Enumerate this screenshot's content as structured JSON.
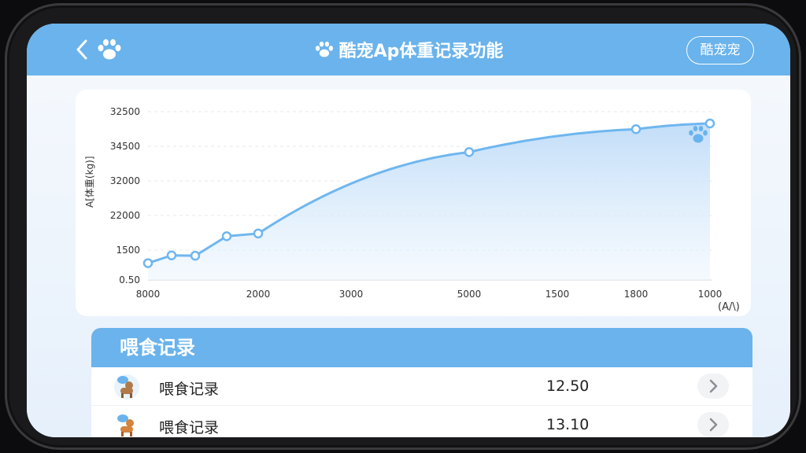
{
  "header": {
    "back_icon": "chevron-left-icon",
    "paw_icon": "paw-icon",
    "title": "酷宠Ap体重记录功能",
    "right_button": "酷宠宠"
  },
  "chart_data": {
    "type": "line",
    "ylabel": "A[体重(kg)]",
    "xlabel": "(A/\\)",
    "y_ticks": [
      "32500",
      "34500",
      "32000",
      "22000",
      "1500",
      "0.50"
    ],
    "x_ticks": [
      "8000",
      "2000",
      "3000",
      "5000",
      "1500",
      "1800",
      "1000"
    ],
    "series": [
      {
        "values": [
          0.5,
          0.73,
          0.72,
          1.3,
          1.38,
          3.8,
          4.48,
          4.65
        ]
      }
    ],
    "grid": true,
    "marker_icon": "paw-icon"
  },
  "feeding": {
    "title": "喂食记录",
    "rows": [
      {
        "avatar": "dog-avatar-icon",
        "label": "喂食记录",
        "value": "12.50"
      },
      {
        "avatar": "dog-avatar-icon",
        "label": "喂食记录",
        "value": "13.10"
      }
    ]
  },
  "colors": {
    "accent": "#6ab3ec",
    "line": "#6fb6ef",
    "fill": "#d7eafb"
  }
}
